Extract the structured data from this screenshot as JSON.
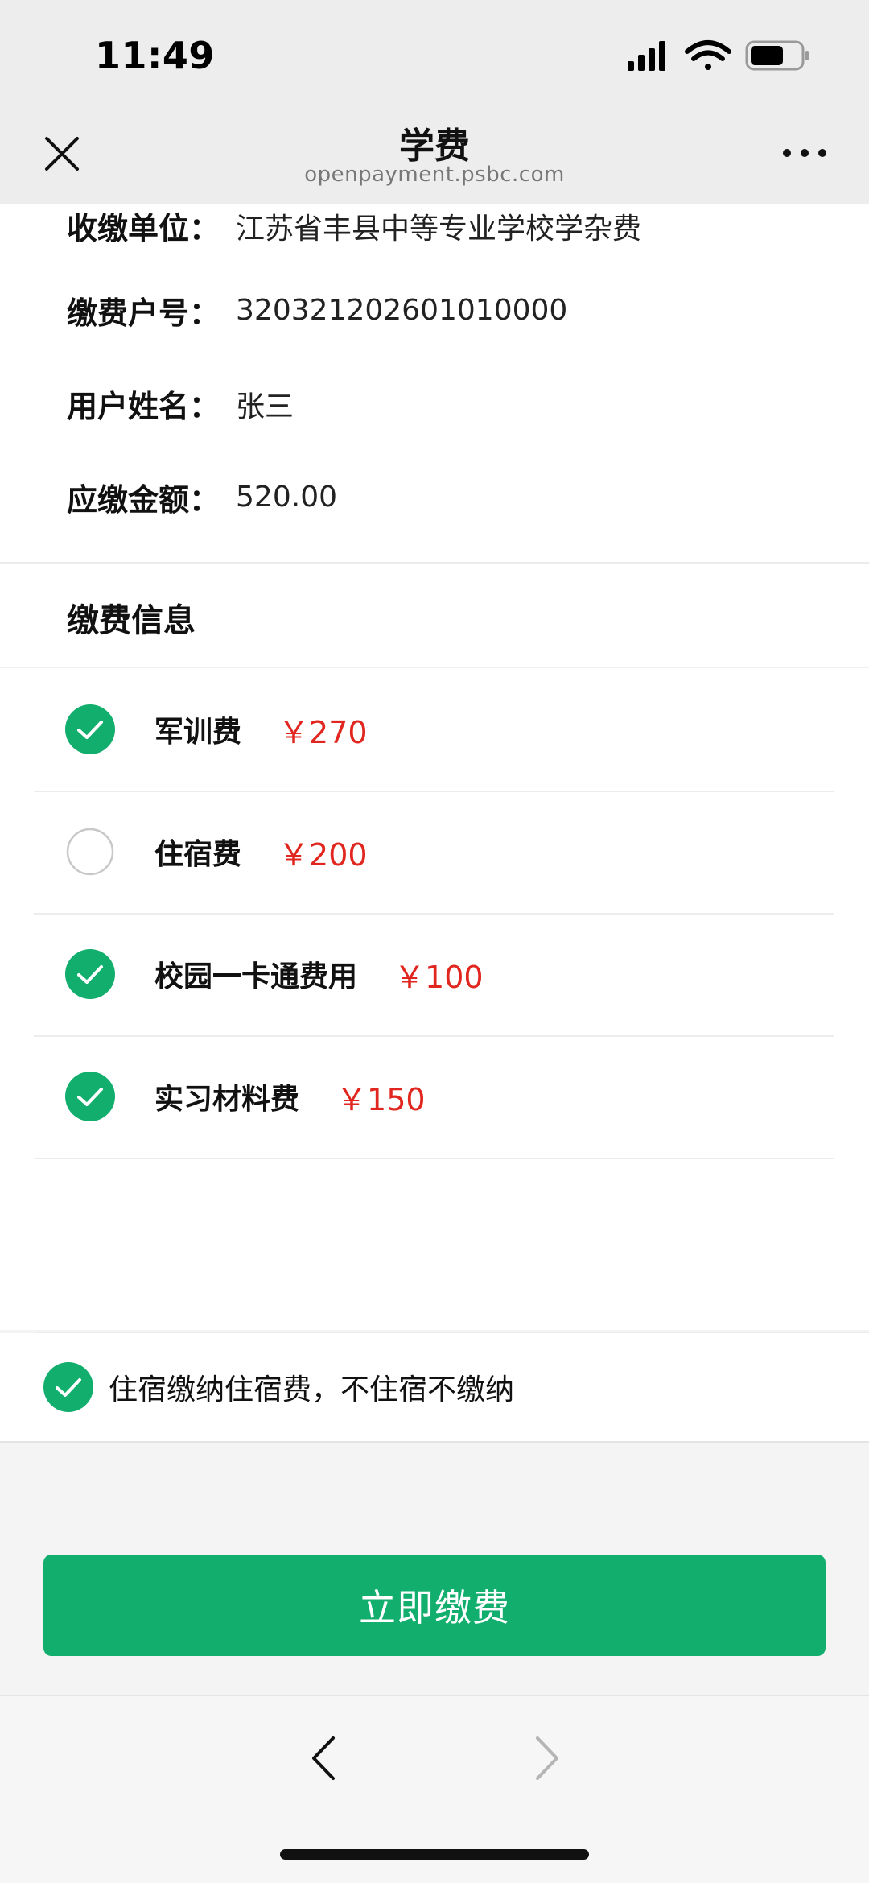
{
  "status_bar": {
    "time": "11:49",
    "icons": [
      "signal-icon",
      "wifi-icon",
      "battery-icon"
    ]
  },
  "nav": {
    "title": "学费",
    "subtitle": "openpayment.psbc.com",
    "close_icon": "close-icon",
    "more_icon": "more-icon"
  },
  "info": {
    "rows": [
      {
        "label": "收缴单位",
        "colon": "：",
        "value": "江苏省丰县中等专业学校学杂费"
      },
      {
        "label": "缴费户号",
        "colon": "：",
        "value": "320321202601010000"
      },
      {
        "label": "用户姓名",
        "colon": "：",
        "value": "张三"
      },
      {
        "label": "应缴金额",
        "colon": "：",
        "value": "520.00"
      }
    ]
  },
  "fees": {
    "header": "缴费信息",
    "items": [
      {
        "name": "军训费",
        "price": "￥270",
        "checked": true
      },
      {
        "name": "住宿费",
        "price": "￥200",
        "checked": false
      },
      {
        "name": "校园一卡通费用",
        "price": "￥100",
        "checked": true
      },
      {
        "name": "实习材料费",
        "price": "￥150",
        "checked": true
      }
    ]
  },
  "note": {
    "text": "住宿缴纳住宿费，不住宿不缴纳",
    "checked": true
  },
  "pay_button": {
    "label": "立即缴费"
  },
  "bottom_nav": {
    "back_icon": "chevron-left-icon",
    "forward_icon": "chevron-right-icon"
  },
  "colors": {
    "accent": "#12ae6e",
    "price": "#e0261e",
    "header_bg": "#ededed"
  }
}
